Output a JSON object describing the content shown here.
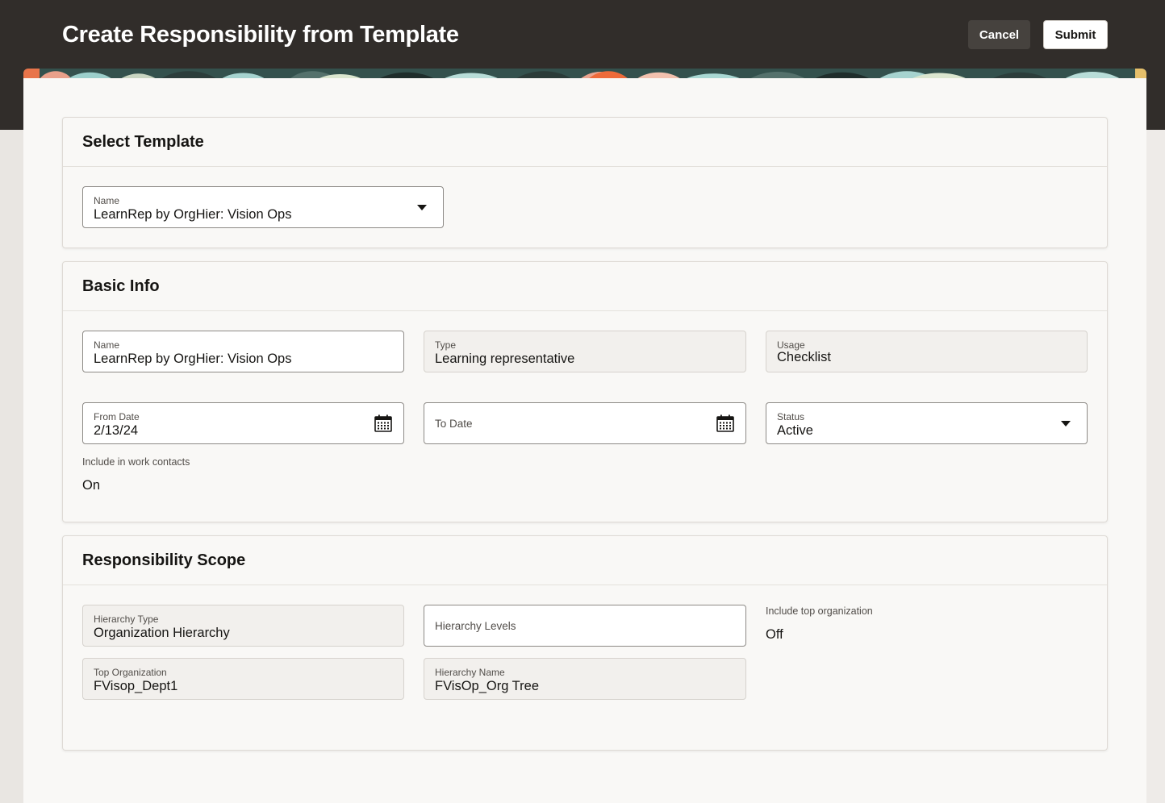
{
  "header": {
    "title": "Create Responsibility from Template",
    "cancel_label": "Cancel",
    "submit_label": "Submit"
  },
  "select_template": {
    "title": "Select Template",
    "name_label": "Name",
    "name_value": "LearnRep by OrgHier: Vision Ops"
  },
  "basic_info": {
    "title": "Basic Info",
    "name_label": "Name",
    "name_value": "LearnRep by OrgHier: Vision Ops",
    "type_label": "Type",
    "type_value": "Learning representative",
    "usage_label": "Usage",
    "usage_value": "Checklist",
    "from_date_label": "From Date",
    "from_date_value": "2/13/24",
    "to_date_label": "To Date",
    "status_label": "Status",
    "status_value": "Active",
    "work_contacts_label": "Include in work contacts",
    "work_contacts_value": "On"
  },
  "scope": {
    "title": "Responsibility Scope",
    "hierarchy_type_label": "Hierarchy Type",
    "hierarchy_type_value": "Organization Hierarchy",
    "hierarchy_levels_label": "Hierarchy Levels",
    "include_top_label": "Include top organization",
    "include_top_value": "Off",
    "top_org_label": "Top Organization",
    "top_org_value": "FVisop_Dept1",
    "hierarchy_name_label": "Hierarchy Name",
    "hierarchy_name_value": "FVisOp_Org Tree"
  },
  "colors": {
    "header_bg": "#312d2a",
    "page_bg": "#f9f8f6",
    "readonly_field_bg": "#f2f0ed",
    "submit_bg": "#ffffff",
    "cancel_bg": "#46423e"
  },
  "icons": {
    "dropdown": "chevron-down-icon",
    "date": "calendar-icon"
  }
}
